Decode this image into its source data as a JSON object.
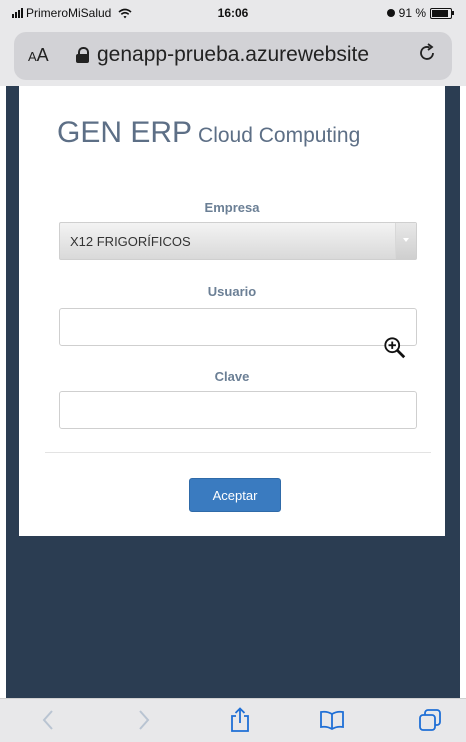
{
  "status_bar": {
    "carrier": "PrimeroMiSalud",
    "time": "16:06",
    "battery": "91 %"
  },
  "browser": {
    "text_size_label_small": "A",
    "text_size_label_large": "A",
    "url": "genapp-prueba.azurewebsite"
  },
  "login": {
    "brand_main": "GEN ERP",
    "brand_sub": "Cloud Computing",
    "company_label": "Empresa",
    "company_value": "X12 FRIGORÍFICOS",
    "user_label": "Usuario",
    "user_value": "",
    "password_label": "Clave",
    "password_value": "",
    "submit_label": "Aceptar"
  },
  "toolbar": {
    "items": [
      "back-icon",
      "forward-icon",
      "share-icon",
      "bookmarks-icon",
      "tabs-icon"
    ]
  },
  "colors": {
    "page_background": "#2b3d52",
    "brand_text": "#5d6f86",
    "button": "#3a7bc0"
  }
}
